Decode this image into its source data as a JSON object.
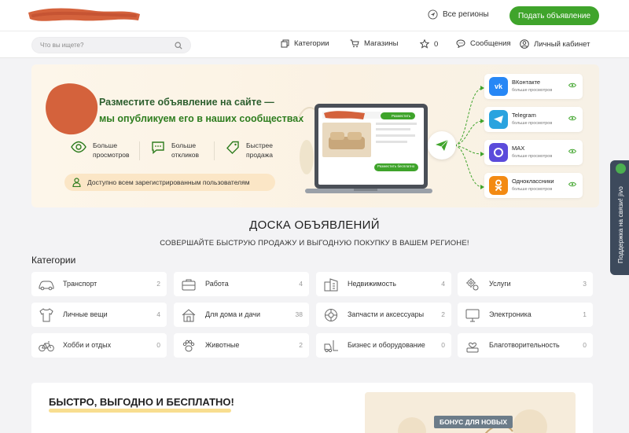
{
  "header": {
    "region_label": "Все регионы",
    "post_button": "Подать объявление"
  },
  "nav": {
    "search_placeholder": "Что вы ищете?",
    "categories": "Категории",
    "shops": "Магазины",
    "favorites_count": "0",
    "messages": "Сообщения",
    "account": "Личный кабинет"
  },
  "banner": {
    "title_line1": "Разместите объявление на сайте —",
    "title_line2": "мы опубликуем его в наших сообществах",
    "features": [
      {
        "label": "Больше\nпросмотров",
        "icon": "eye-icon"
      },
      {
        "label": "Больше\nоткликов",
        "icon": "chat-icon"
      },
      {
        "label": "Быстрее\nпродажа",
        "icon": "tag-icon"
      }
    ],
    "registered_note": "Доступно всем зарегистрированным пользователям",
    "laptop_button_top": "Разместить",
    "laptop_button_bottom": "Разместить бесплатно",
    "socials": [
      {
        "name": "ВКонтакте",
        "sub": "больше просмотров",
        "color": "#2787f5",
        "icon": "vk-icon"
      },
      {
        "name": "Telegram",
        "sub": "больше просмотров",
        "color": "#2aa3df",
        "icon": "telegram-icon"
      },
      {
        "name": "MAX",
        "sub": "больше просмотров",
        "color": "#5b4bdb",
        "icon": "max-icon"
      },
      {
        "name": "Одноклассники",
        "sub": "больше просмотров",
        "color": "#f38a12",
        "icon": "ok-icon"
      }
    ]
  },
  "board": {
    "title": "ДОСКА ОБЪЯВЛЕНИЙ",
    "subtitle": "СОВЕРШАЙТЕ БЫСТРУЮ ПРОДАЖУ И ВЫГОДНУЮ ПОКУПКУ В ВАШЕМ РЕГИОНЕ!",
    "categories_heading": "Категории"
  },
  "categories": [
    {
      "label": "Транспорт",
      "count": "2",
      "icon": "car-icon"
    },
    {
      "label": "Работа",
      "count": "4",
      "icon": "briefcase-icon"
    },
    {
      "label": "Недвижимость",
      "count": "4",
      "icon": "buildings-icon"
    },
    {
      "label": "Услуги",
      "count": "3",
      "icon": "gears-icon"
    },
    {
      "label": "Личные вещи",
      "count": "4",
      "icon": "shirt-icon"
    },
    {
      "label": "Для дома и дачи",
      "count": "38",
      "icon": "house-icon"
    },
    {
      "label": "Запчасти и аксессуары",
      "count": "2",
      "icon": "wheel-icon"
    },
    {
      "label": "Электроника",
      "count": "1",
      "icon": "monitor-icon"
    },
    {
      "label": "Хобби и отдых",
      "count": "0",
      "icon": "bicycle-icon"
    },
    {
      "label": "Животные",
      "count": "2",
      "icon": "paw-icon"
    },
    {
      "label": "Бизнес и оборудование",
      "count": "0",
      "icon": "forklift-icon"
    },
    {
      "label": "Благотворительность",
      "count": "0",
      "icon": "charity-icon"
    }
  ],
  "bottom": {
    "title": "БЫСТРО, ВЫГОДНО И БЕСПЛАТНО!",
    "promo_badge": "БОНУС ДЛЯ НОВЫХ"
  },
  "side_tab": {
    "label": "Поддержка на связи! jivo"
  },
  "colors": {
    "brand_green": "#3fa42b",
    "banner_bg": "#fdf6ea",
    "redaction": "#d4623c"
  }
}
